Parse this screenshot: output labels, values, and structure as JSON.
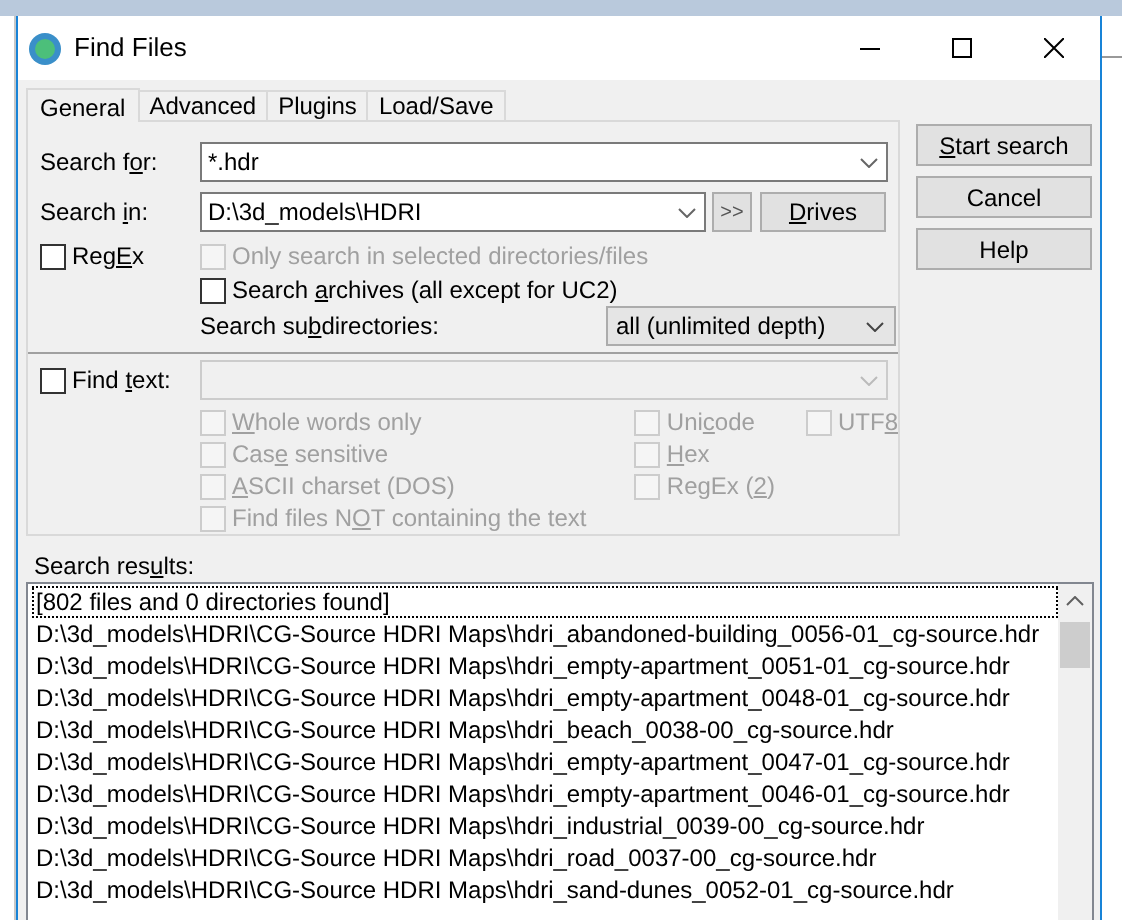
{
  "window": {
    "title": "Find Files"
  },
  "tabs": [
    {
      "label": "General",
      "selected": true
    },
    {
      "label": "Advanced",
      "selected": false
    },
    {
      "label": "Plugins",
      "selected": false
    },
    {
      "label": "Load/Save",
      "selected": false
    }
  ],
  "search_for": {
    "label": {
      "before": "Search f",
      "key": "o",
      "after": "r:"
    },
    "value": "*.hdr"
  },
  "search_in": {
    "label": {
      "before": "Search ",
      "key": "i",
      "after": "n:"
    },
    "value": "D:\\3d_models\\HDRI",
    "more_button": ">>",
    "drives_button": {
      "key": "D",
      "after": "rives"
    }
  },
  "regex": {
    "label": {
      "before": "Reg",
      "key": "E",
      "after": "x"
    },
    "checked": false,
    "disabled": false
  },
  "only_selected": {
    "label": {
      "before": "Only search in selected directories/files"
    },
    "checked": false,
    "disabled": true
  },
  "search_archives": {
    "label": {
      "before": "Search ",
      "key": "a",
      "after": "rchives (all except for UC2)"
    },
    "checked": false,
    "disabled": false
  },
  "subdirectories": {
    "label": {
      "before": "Search su",
      "key": "b",
      "after": "directories:"
    },
    "value": "all (unlimited depth)"
  },
  "find_text": {
    "label": {
      "before": "Find ",
      "key": "t",
      "after": "ext:"
    },
    "checked": false,
    "field_disabled": true
  },
  "text_options_left": [
    {
      "label": {
        "key": "W",
        "after": "hole words only"
      },
      "checked": false,
      "disabled": true
    },
    {
      "label": {
        "before": "Cas",
        "key": "e",
        "after": " sensitive"
      },
      "checked": false,
      "disabled": true
    },
    {
      "label": {
        "key": "A",
        "after": "SCII charset (DOS)"
      },
      "checked": false,
      "disabled": true
    },
    {
      "label": {
        "before": "Find files N",
        "key": "O",
        "after": "T containing the text"
      },
      "checked": false,
      "disabled": true
    }
  ],
  "text_options_middle": [
    {
      "label": {
        "before": "Uni",
        "key": "c",
        "after": "ode"
      },
      "checked": false,
      "disabled": true
    },
    {
      "label": {
        "key": "H",
        "after": "ex"
      },
      "checked": false,
      "disabled": true
    },
    {
      "label": {
        "before": "RegEx (",
        "key": "2",
        "after": ")"
      },
      "checked": false,
      "disabled": true
    }
  ],
  "text_options_right": [
    {
      "label": {
        "before": "UTF",
        "key": "8"
      },
      "checked": false,
      "disabled": true
    }
  ],
  "buttons": [
    {
      "label": {
        "key": "S",
        "after": "tart search"
      }
    },
    {
      "label": {
        "before": "Cancel"
      }
    },
    {
      "label": {
        "before": "Help"
      }
    }
  ],
  "results": {
    "label": {
      "before": "Search res",
      "key": "u",
      "after": "lts:"
    },
    "summary": "[802 files and 0 directories found]",
    "rows": [
      "D:\\3d_models\\HDRI\\CG-Source HDRI Maps\\hdri_abandoned-building_0056-01_cg-source.hdr",
      "D:\\3d_models\\HDRI\\CG-Source HDRI Maps\\hdri_empty-apartment_0051-01_cg-source.hdr",
      "D:\\3d_models\\HDRI\\CG-Source HDRI Maps\\hdri_empty-apartment_0048-01_cg-source.hdr",
      "D:\\3d_models\\HDRI\\CG-Source HDRI Maps\\hdri_beach_0038-00_cg-source.hdr",
      "D:\\3d_models\\HDRI\\CG-Source HDRI Maps\\hdri_empty-apartment_0047-01_cg-source.hdr",
      "D:\\3d_models\\HDRI\\CG-Source HDRI Maps\\hdri_empty-apartment_0046-01_cg-source.hdr",
      "D:\\3d_models\\HDRI\\CG-Source HDRI Maps\\hdri_industrial_0039-00_cg-source.hdr",
      "D:\\3d_models\\HDRI\\CG-Source HDRI Maps\\hdri_road_0037-00_cg-source.hdr",
      "D:\\3d_models\\HDRI\\CG-Source HDRI Maps\\hdri_sand-dunes_0052-01_cg-source.hdr"
    ]
  }
}
